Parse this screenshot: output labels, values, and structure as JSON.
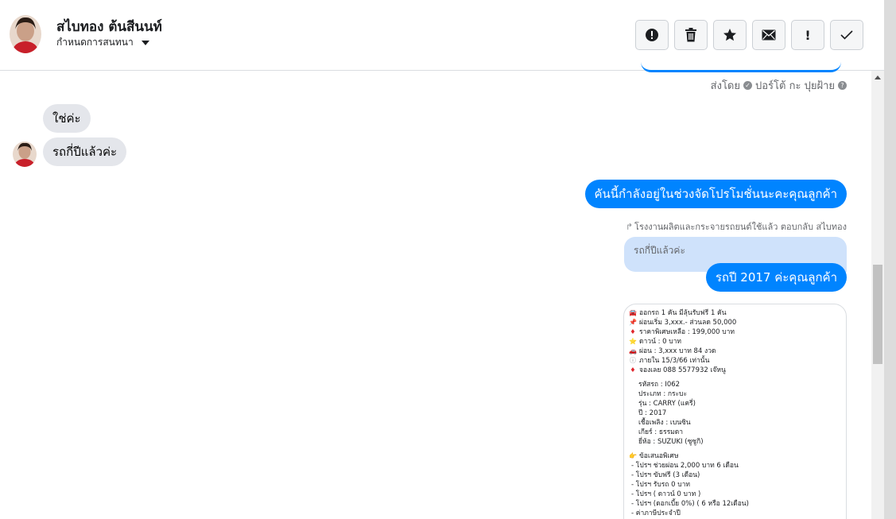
{
  "header": {
    "contact_name": "สไบทอง ต้นสีนนท์",
    "assign_label": "กำหนดการสนทนา"
  },
  "toolbar": {
    "buttons": [
      {
        "icon": "alert-circle-icon"
      },
      {
        "icon": "trash-icon"
      },
      {
        "icon": "star-icon"
      },
      {
        "icon": "envelope-icon"
      },
      {
        "icon": "exclamation-icon",
        "text": "!"
      },
      {
        "icon": "check-icon"
      }
    ]
  },
  "conversation": {
    "sent_by_prefix": "ส่งโดย",
    "sent_by_name": "ปอร์โต้ กะ ปุยฝ้าย",
    "incoming": [
      {
        "text": "ใช่ค่ะ"
      },
      {
        "text": "รถกี่ปีแล้วค่ะ"
      }
    ],
    "outgoing_1": "คันนี้กำลังอยู่ในช่วงจัดโปรโมชั่นนะคะคุณลูกค้า",
    "reply_meta": "โรงงานผลิตและกระจายรถยนต์ใช้แล้ว ตอบกลับ สไบทอง",
    "quoted_text": "รถกี่ปีแล้วค่ะ",
    "outgoing_2": "รถปี 2017 ค่ะคุณลูกค้า"
  },
  "card": {
    "lines": [
      {
        "emoji": "🚘",
        "text": "ออกรถ 1 คัน มีลุ้นรับฟรี 1 คัน"
      },
      {
        "emoji": "📌",
        "text": "ผ่อนเริ่ม 3,xxx.-  ส่วนลด 50,000"
      },
      {
        "emoji": "♦",
        "text": "ราคาพิเศษเหลือ : 199,000 บาท"
      },
      {
        "emoji": "⭐",
        "text": "ดาวน์ : 0 บาท"
      },
      {
        "emoji": "🚗",
        "text": "ผ่อน : 3,xxx บาท 84 งวด"
      },
      {
        "emoji": "ⓘ",
        "text": "ภายใน 15/3/66 เท่านั้น"
      },
      {
        "emoji": "♦",
        "text": "จองเลย 088 5577932 เจ๊หนู"
      }
    ],
    "specs": [
      "รหัสรถ : I062",
      "ประเภท : กระบะ",
      "รุ่น : CARRY (แครี่)",
      "ปี : 2017",
      "เชื้อเพลิง : เบนซิน",
      "เกียร์ : ธรรมดา",
      "ยี่ห้อ : SUZUKI (ซูซูกิ)"
    ],
    "promo_title_emoji": "👉",
    "promo_title": "ข้อเสนอพิเศษ",
    "promo_items": [
      "- โปรฯ ช่วยผ่อน 2,000 บาท 6 เดือน",
      "- โปรฯ ขับฟรี (3 เดือน)",
      "- โปรฯ รับรถ 0 บาท",
      "- โปรฯ ( ดาวน์ 0 บาท )",
      "- โปรฯ (ดอกเบี้ย 0%) ( 6 หรือ 12เดือน)",
      "- ค่าภาษีประจำปี"
    ]
  },
  "colors": {
    "accent": "#0084ff",
    "incoming_bubble": "#e4e6eb",
    "quoted_bg": "#cfe2fb"
  }
}
